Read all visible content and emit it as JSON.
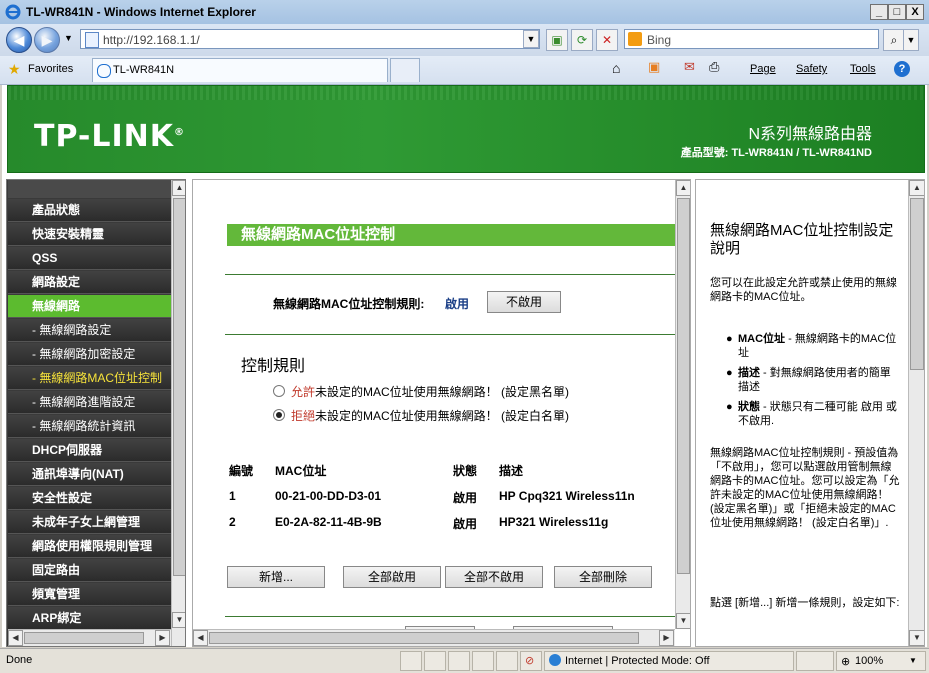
{
  "window": {
    "title": "TL-WR841N - Windows Internet Explorer",
    "min": "_",
    "max": "□",
    "close": "X"
  },
  "toolbar": {
    "url": "http://192.168.1.1/",
    "search_engine": "Bing",
    "tab_label": "TL-WR841N",
    "favorites_label": "Favorites",
    "page_menu": "Page",
    "safety_menu": "Safety",
    "tools_menu": "Tools",
    "help_glyph": "?"
  },
  "banner": {
    "logo": "TP-LINK",
    "product_name": "N系列無線路由器",
    "model": "產品型號: TL-WR841N / TL-WR841ND"
  },
  "nav": {
    "items": [
      {
        "label": "產品狀態",
        "kind": "main"
      },
      {
        "label": "快速安裝精靈",
        "kind": "main"
      },
      {
        "label": "QSS",
        "kind": "main"
      },
      {
        "label": "網路設定",
        "kind": "main"
      },
      {
        "label": "無線網路",
        "kind": "active"
      },
      {
        "label": "- 無線網路設定",
        "kind": "sub"
      },
      {
        "label": "- 無線網路加密設定",
        "kind": "sub"
      },
      {
        "label": "- 無線網路MAC位址控制",
        "kind": "activesub"
      },
      {
        "label": "- 無線網路進階設定",
        "kind": "sub"
      },
      {
        "label": "- 無線網路統計資訊",
        "kind": "sub"
      },
      {
        "label": "DHCP伺服器",
        "kind": "main"
      },
      {
        "label": "通訊埠導向(NAT)",
        "kind": "main"
      },
      {
        "label": "安全性設定",
        "kind": "main"
      },
      {
        "label": "未成年子女上網管理",
        "kind": "main"
      },
      {
        "label": "網路使用權限規則管理",
        "kind": "main"
      },
      {
        "label": "固定路由",
        "kind": "main"
      },
      {
        "label": "頻寬管理",
        "kind": "main"
      },
      {
        "label": "ARP綁定",
        "kind": "main"
      }
    ]
  },
  "main": {
    "title": "無線網路MAC位址控制",
    "rule_label": "無線網路MAC位址控制規則:",
    "rule_status": "啟用",
    "disable_button": "不啟用",
    "section_title": "控制規則",
    "allow_keyword": "允許",
    "allow_text": "未設定的MAC位址使用無線網路！ (設定黑名單)",
    "deny_keyword": "拒絕",
    "deny_text": "未設定的MAC位址使用無線網路！ (設定白名單)",
    "table": {
      "headers": [
        "編號",
        "MAC位址",
        "狀態",
        "描述"
      ],
      "rows": [
        [
          "1",
          "00-21-00-DD-D3-01",
          "啟用",
          "HP Cpq321 Wireless11n"
        ],
        [
          "2",
          "E0-2A-82-11-4B-9B",
          "啟用",
          "HP321 Wireless11g"
        ]
      ]
    },
    "buttons": {
      "add": "新增...",
      "enable_all": "全部啟用",
      "disable_all": "全部不啟用",
      "delete_all": "全部刪除"
    }
  },
  "help": {
    "title": "無線網路MAC位址控制設定說明",
    "intro": "您可以在此設定允許或禁止使用的無線網路卡的MAC位址。",
    "bullets": [
      {
        "term": "MAC位址",
        "desc": " - 無線網路卡的MAC位址"
      },
      {
        "term": "描述",
        "desc": " - 對無線網路使用者的簡單描述"
      },
      {
        "term": "狀態",
        "desc": " - 狀態只有二種可能 啟用 或 不啟用."
      }
    ],
    "para1": "無線網路MAC位址控制規則 - 預設值為「不啟用」，您可以點選啟用管制無線網路卡的MAC位址。您可以設定為「允許未設定的MAC位址使用無線網路！ (設定黑名單)」或「拒絕未設定的MAC位址使用無線網路！ (設定白名單)」.",
    "para2": "點選 [新增...] 新增一條規則，設定如下:"
  },
  "status": {
    "left": "Done",
    "zone": "Internet | Protected Mode: Off",
    "zoom": "100%"
  }
}
